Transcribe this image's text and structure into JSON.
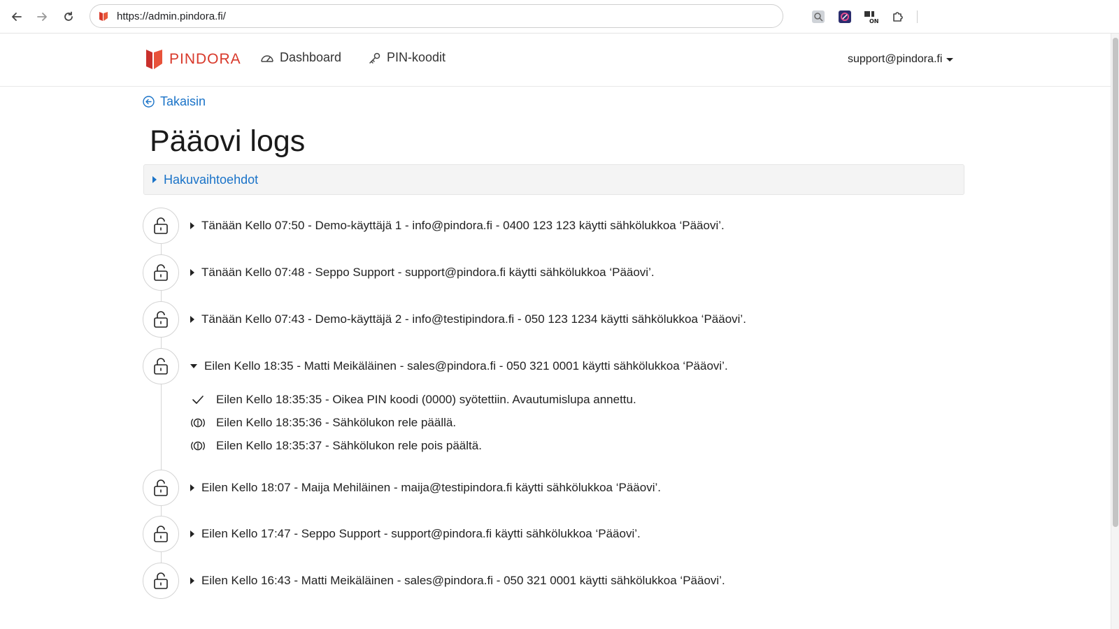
{
  "browser": {
    "url": "https://admin.pindora.fi/",
    "extensions": [
      "magnifier-extension-icon",
      "color-picker-extension-icon",
      "toggle-on-extension-icon",
      "puzzle-extensions-icon"
    ]
  },
  "header": {
    "brand": "PINDORA",
    "brand_color": "#d8382a",
    "nav": [
      {
        "label": "Dashboard",
        "icon": "speedometer-icon"
      },
      {
        "label": "PIN-koodit",
        "icon": "key-icon"
      }
    ],
    "user": "support@pindora.fi"
  },
  "main": {
    "back_label": "Takaisin",
    "title": "Pääovi logs",
    "search_options_label": "Hakuvaihtoehdot",
    "accent_color": "#1a73c8",
    "entries": [
      {
        "text": "Tänään Kello 07:50 - Demo-käyttäjä 1 - info@pindora.fi - 0400 123 123 käytti sähkölukkoa ‘Pääovi’.",
        "expanded": false
      },
      {
        "text": "Tänään Kello 07:48 - Seppo Support - support@pindora.fi käytti sähkölukkoa ‘Pääovi’.",
        "expanded": false
      },
      {
        "text": "Tänään Kello 07:43 - Demo-käyttäjä 2 - info@testipindora.fi - 050 123 1234 käytti sähkölukkoa ‘Pääovi’.",
        "expanded": false
      },
      {
        "text": "Eilen Kello 18:35 - Matti Meikäläinen - sales@pindora.fi - 050 321 0001 käytti sähkölukkoa ‘Pääovi’.",
        "expanded": true
      },
      {
        "text": "Eilen Kello 18:07 - Maija Mehiläinen - maija@testipindora.fi käytti sähkölukkoa ‘Pääovi’.",
        "expanded": false
      },
      {
        "text": "Eilen Kello 17:47 - Seppo Support - support@pindora.fi käytti sähkölukkoa ‘Pääovi’.",
        "expanded": false
      },
      {
        "text": "Eilen Kello 16:43 - Matti Meikäläinen - sales@pindora.fi - 050 321 0001 käytti sähkölukkoa ‘Pääovi’.",
        "expanded": false
      }
    ],
    "details": [
      {
        "icon": "checkmark-icon",
        "text": "Eilen Kello 18:35:35 - Oikea PIN koodi (0000) syötettiin. Avautumislupa annettu."
      },
      {
        "icon": "alert-signal-icon",
        "text": "Eilen Kello 18:35:36 - Sähkölukon rele päällä."
      },
      {
        "icon": "alert-signal-icon",
        "text": "Eilen Kello 18:35:37 - Sähkölukon rele pois päältä."
      }
    ]
  }
}
